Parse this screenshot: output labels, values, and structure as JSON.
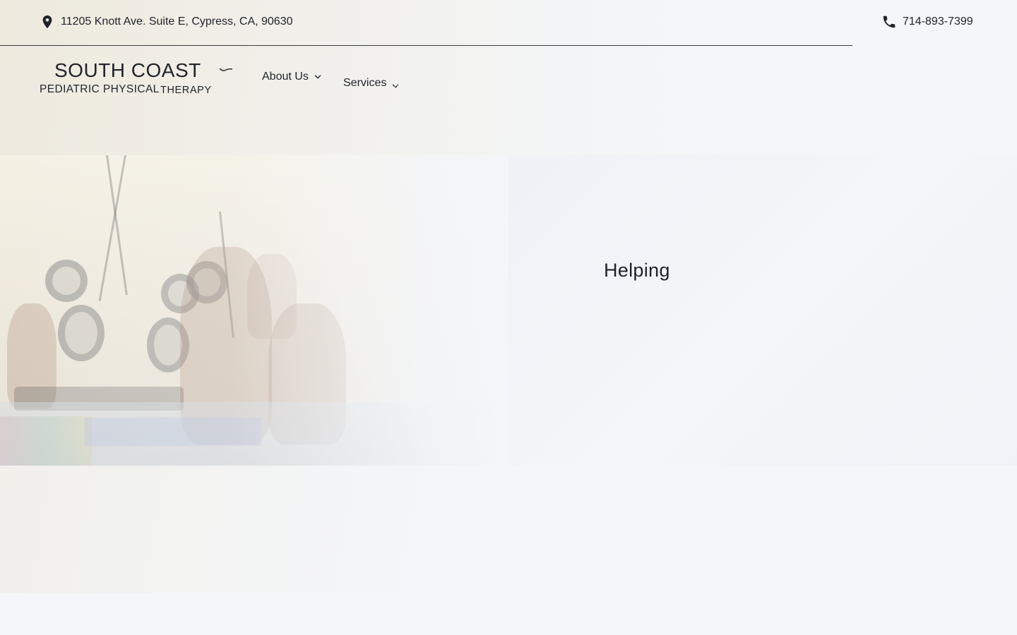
{
  "topbar": {
    "address": "11205 Knott Ave. Suite E, Cypress, CA, 90630",
    "address_icon": "location-pin-icon",
    "phone": "714-893-7399",
    "phone_icon": "phone-icon"
  },
  "logo": {
    "main": "SOUTH COAST",
    "sub_line1": "PEDIATRIC PHYSICAL",
    "sub_line2": "THERAPY"
  },
  "nav": {
    "items": [
      {
        "label": "About Us",
        "icon": "chevron-down-icon"
      },
      {
        "label": "Services",
        "icon": "chevron-down-icon"
      }
    ]
  },
  "hero": {
    "heading": "Helping"
  },
  "colors": {
    "text": "#1f2329",
    "background": "#f4f6f9",
    "divider": "#3a3d42"
  }
}
